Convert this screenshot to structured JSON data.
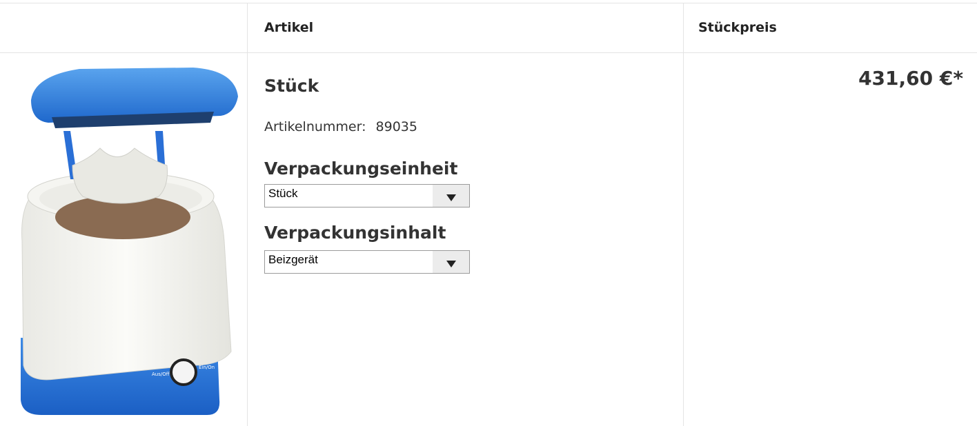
{
  "table": {
    "headers": {
      "image": "",
      "article": "Artikel",
      "unit_price": "Stückpreis"
    }
  },
  "product": {
    "image_icon": "product-image",
    "title": "Stück",
    "article_number_label": "Artikelnummer:",
    "article_number": "89035",
    "packaging_unit": {
      "label": "Verpackungseinheit",
      "selected": "Stück"
    },
    "packaging_content": {
      "label": "Verpackungsinhalt",
      "selected": "Beizgerät"
    },
    "price": "431,60 €*"
  },
  "colors": {
    "device_blue": "#2f7ce0",
    "border": "#e4e4e4"
  }
}
